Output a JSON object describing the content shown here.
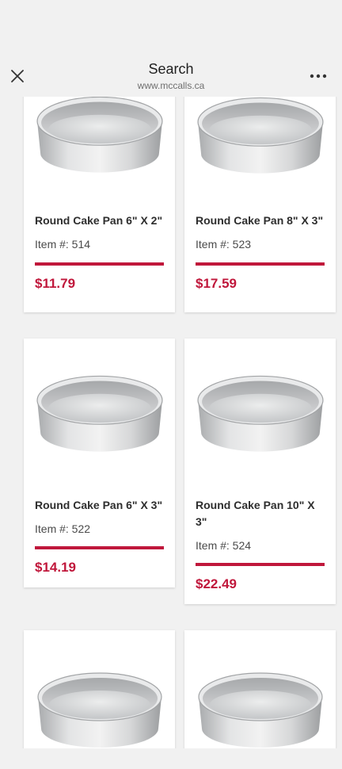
{
  "header": {
    "title": "Search",
    "url": "www.mccalls.ca"
  },
  "products": [
    {
      "name": "Round Cake Pan 6\" X 2\"",
      "item": "Item #: 514",
      "price": "$11.79"
    },
    {
      "name": "Round Cake Pan 8\" X 3\"",
      "item": "Item #: 523",
      "price": "$17.59"
    },
    {
      "name": "Round Cake Pan 6\" X 3\"",
      "item": "Item #: 522",
      "price": "$14.19"
    },
    {
      "name": "Round Cake Pan 10\" X 3\"",
      "item": "Item #: 524",
      "price": "$22.49"
    }
  ],
  "colors": {
    "accent": "#c0173b",
    "background": "#f1f1f1",
    "card": "#ffffff"
  },
  "icons": {
    "close": "close-icon",
    "more": "more-icon",
    "product_image": "round-cake-pan-image"
  }
}
